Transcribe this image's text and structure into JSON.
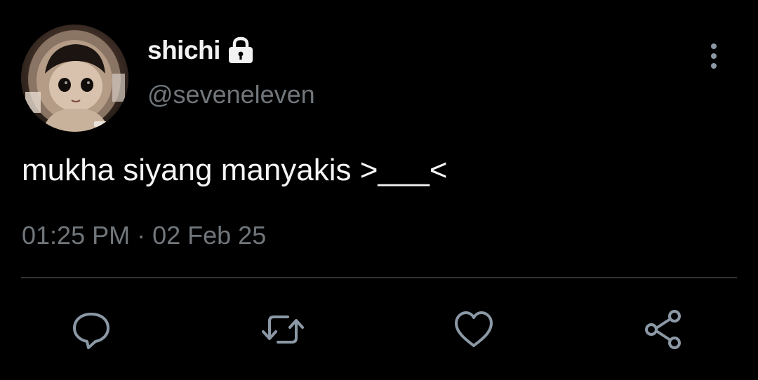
{
  "author": {
    "display_name": "shichi",
    "handle": "@seveneleven",
    "protected": true,
    "avatar": "avatar-photo"
  },
  "tweet": {
    "text": "mukha siyang manyakis >___<",
    "time": "01:25 PM",
    "separator": "·",
    "date": "02 Feb 25"
  },
  "actions": [
    {
      "name": "reply",
      "icon": "reply-bubble-icon"
    },
    {
      "name": "retweet",
      "icon": "retweet-icon"
    },
    {
      "name": "like",
      "icon": "heart-icon"
    },
    {
      "name": "share",
      "icon": "share-icon"
    }
  ],
  "colors": {
    "background": "#000000",
    "primary_text": "#f5f5f5",
    "secondary_text": "#71767b",
    "divider": "#2f3336",
    "icon": "#8b98a5"
  }
}
